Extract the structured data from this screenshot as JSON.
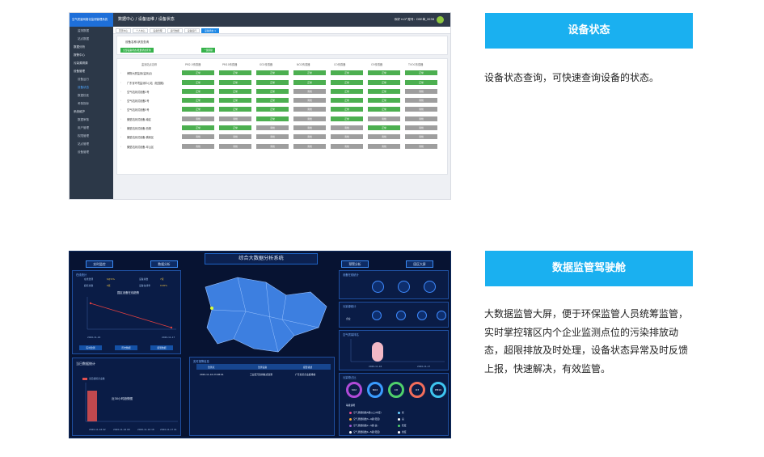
{
  "section1": {
    "banner_title": "设备状态",
    "description": "设备状态查询，可快速查询设备的状态。",
    "screenshot": {
      "logo_text": "空气质量网格化监测管理系统",
      "sidebar_items": [
        {
          "label": "监测数据",
          "type": "item"
        },
        {
          "label": "站点数据",
          "type": "item"
        },
        {
          "label": "数据分析",
          "type": "group"
        },
        {
          "label": "报警中心",
          "type": "group"
        },
        {
          "label": "污染源溯源",
          "type": "group"
        },
        {
          "label": "设备管理",
          "type": "group"
        },
        {
          "label": "设备运行",
          "type": "item"
        },
        {
          "label": "设备状态",
          "type": "active"
        },
        {
          "label": "数据校准",
          "type": "item"
        },
        {
          "label": "考核指标",
          "type": "item"
        },
        {
          "label": "系统维护",
          "type": "group"
        },
        {
          "label": "数据审核",
          "type": "item"
        },
        {
          "label": "用户管理",
          "type": "item"
        },
        {
          "label": "权限管理",
          "type": "item"
        },
        {
          "label": "站点管理",
          "type": "item"
        },
        {
          "label": "设备管理",
          "type": "item"
        }
      ],
      "breadcrumb": "数据中心 / 设备运维 / 设备状态",
      "user_info": "你好 ▾    Ω⁶    账号：DSE单_2036",
      "tabs": [
        "首页中心",
        "个人中心",
        "设备管理",
        "运行数据",
        "设备运行",
        "设备状态 ×"
      ],
      "filter_title": "设备名称/状态查询",
      "filter_btn1": "全部设备状态/批量状态查询",
      "filter_btn2": "一键刷新",
      "columns": [
        "监测站点名称",
        "PM2.5传感器",
        "PM10传感器",
        "SO2传感器",
        "NO2传感器",
        "CO传感器",
        "O3传感器",
        "TVOC传感器"
      ],
      "rows": [
        {
          "name": "博物大厦监测(监测点)",
          "status": [
            "正常",
            "正常",
            "正常",
            "正常",
            "正常",
            "正常",
            "正常"
          ]
        },
        {
          "name": "广东省环境监测中心站（松园路）",
          "status": [
            "正常",
            "正常",
            "正常",
            "正常",
            "正常",
            "正常",
            "正常"
          ]
        },
        {
          "name": "空气站测试设备1号",
          "status": [
            "正常",
            "正常",
            "正常",
            "离线",
            "正常",
            "正常",
            "离线"
          ]
        },
        {
          "name": "空气站测试设备2号",
          "status": [
            "正常",
            "正常",
            "正常",
            "离线",
            "正常",
            "正常",
            "离线"
          ]
        },
        {
          "name": "空气站测试设备3号",
          "status": [
            "正常",
            "正常",
            "正常",
            "离线",
            "正常",
            "正常",
            "离线"
          ]
        },
        {
          "name": "微型站测试设备-南区",
          "status": [
            "离线",
            "离线",
            "正常",
            "离线",
            "正常",
            "离线",
            "离线"
          ]
        },
        {
          "name": "微型站测试设备-西湖",
          "status": [
            "正常",
            "正常",
            "离线",
            "离线",
            "离线",
            "正常",
            "离线"
          ]
        },
        {
          "name": "微型站测试设备-横岗区",
          "status": [
            "离线",
            "离线",
            "离线",
            "离线",
            "离线",
            "离线",
            "离线"
          ]
        },
        {
          "name": "微型站测试设备-坪山区",
          "status": [
            "离线",
            "离线",
            "离线",
            "离线",
            "离线",
            "离线",
            "离线"
          ]
        }
      ]
    }
  },
  "section2": {
    "banner_title": "数据监管驾驶舱",
    "description": "大数据监管大屏，便于环保监管人员统筹监管，实时掌控辖区内个企业监测点位的污染排放动态，超限排放及时处理，设备状态异常及时反馈上报，快速解决，有效监管。",
    "screenshot": {
      "title": "综合大数据分析系统",
      "btn_realtime": "实时监控",
      "btn_analysis": "数据分析",
      "btn_alarm": "预警分析",
      "btn_screen": "园区大屏",
      "left_panel_title": "在线统计",
      "stats": [
        {
          "label": "在线监测",
          "value": "$@%%"
        },
        {
          "label": "设备总数",
          "value": "7家"
        },
        {
          "label": "超标总数",
          "value": "0家"
        },
        {
          "label": "设备在线率",
          "value": "0.00%"
        }
      ],
      "chart1_title": "园区设备在线趋势",
      "chart1_dates": [
        "2020-11-16",
        "2020-11-17"
      ],
      "mini_buttons": [
        "实时监测",
        "历史数据",
        "报警数据"
      ],
      "left2_title": "当日数据统计",
      "left2_legend": "当日超标企业数",
      "chart2_title": "近30小时趋势图",
      "chart2_dates": [
        "2020-11-16 02",
        "2020-11-16 09",
        "2020-11-16 18",
        "2020-11-17 01"
      ],
      "table_title": "实时报警信息",
      "table_headers": [
        "监测点",
        "监测设备",
        "报警描述"
      ],
      "table_row": [
        "2020-11-16 23:08:01",
        "工业区污染排放点监测",
        "广东省某企业超排放"
      ],
      "right1_title": "设备在线统计",
      "right2_title": "污染源统计",
      "right2_label": "企业",
      "right3_title": "空气质量排名",
      "chart3_dates": [
        "2020-11-16",
        "2020-11-17"
      ],
      "right4_title": "污染物占比",
      "ring_labels": [
        "SO2",
        "NO2",
        "CO",
        "O3",
        "PM10"
      ],
      "legend_title": "等级说明",
      "legends": [
        {
          "label": "空气质量指数5级以上(中度)",
          "color": "#e64a8a"
        },
        {
          "label": "优",
          "color": "#66ccff"
        },
        {
          "label": "空气质量指数3~4级(轻度)",
          "color": "#f7a934"
        },
        {
          "label": "良",
          "color": "#ffffff"
        },
        {
          "label": "空气质量指数2~3级(良)",
          "color": "#9b59d0"
        },
        {
          "label": "轻度",
          "color": "#4fd06b"
        },
        {
          "label": "空气质量指数4~5级(轻度)",
          "color": "#ffffff"
        },
        {
          "label": "重度",
          "color": "#ffffff"
        }
      ]
    }
  }
}
